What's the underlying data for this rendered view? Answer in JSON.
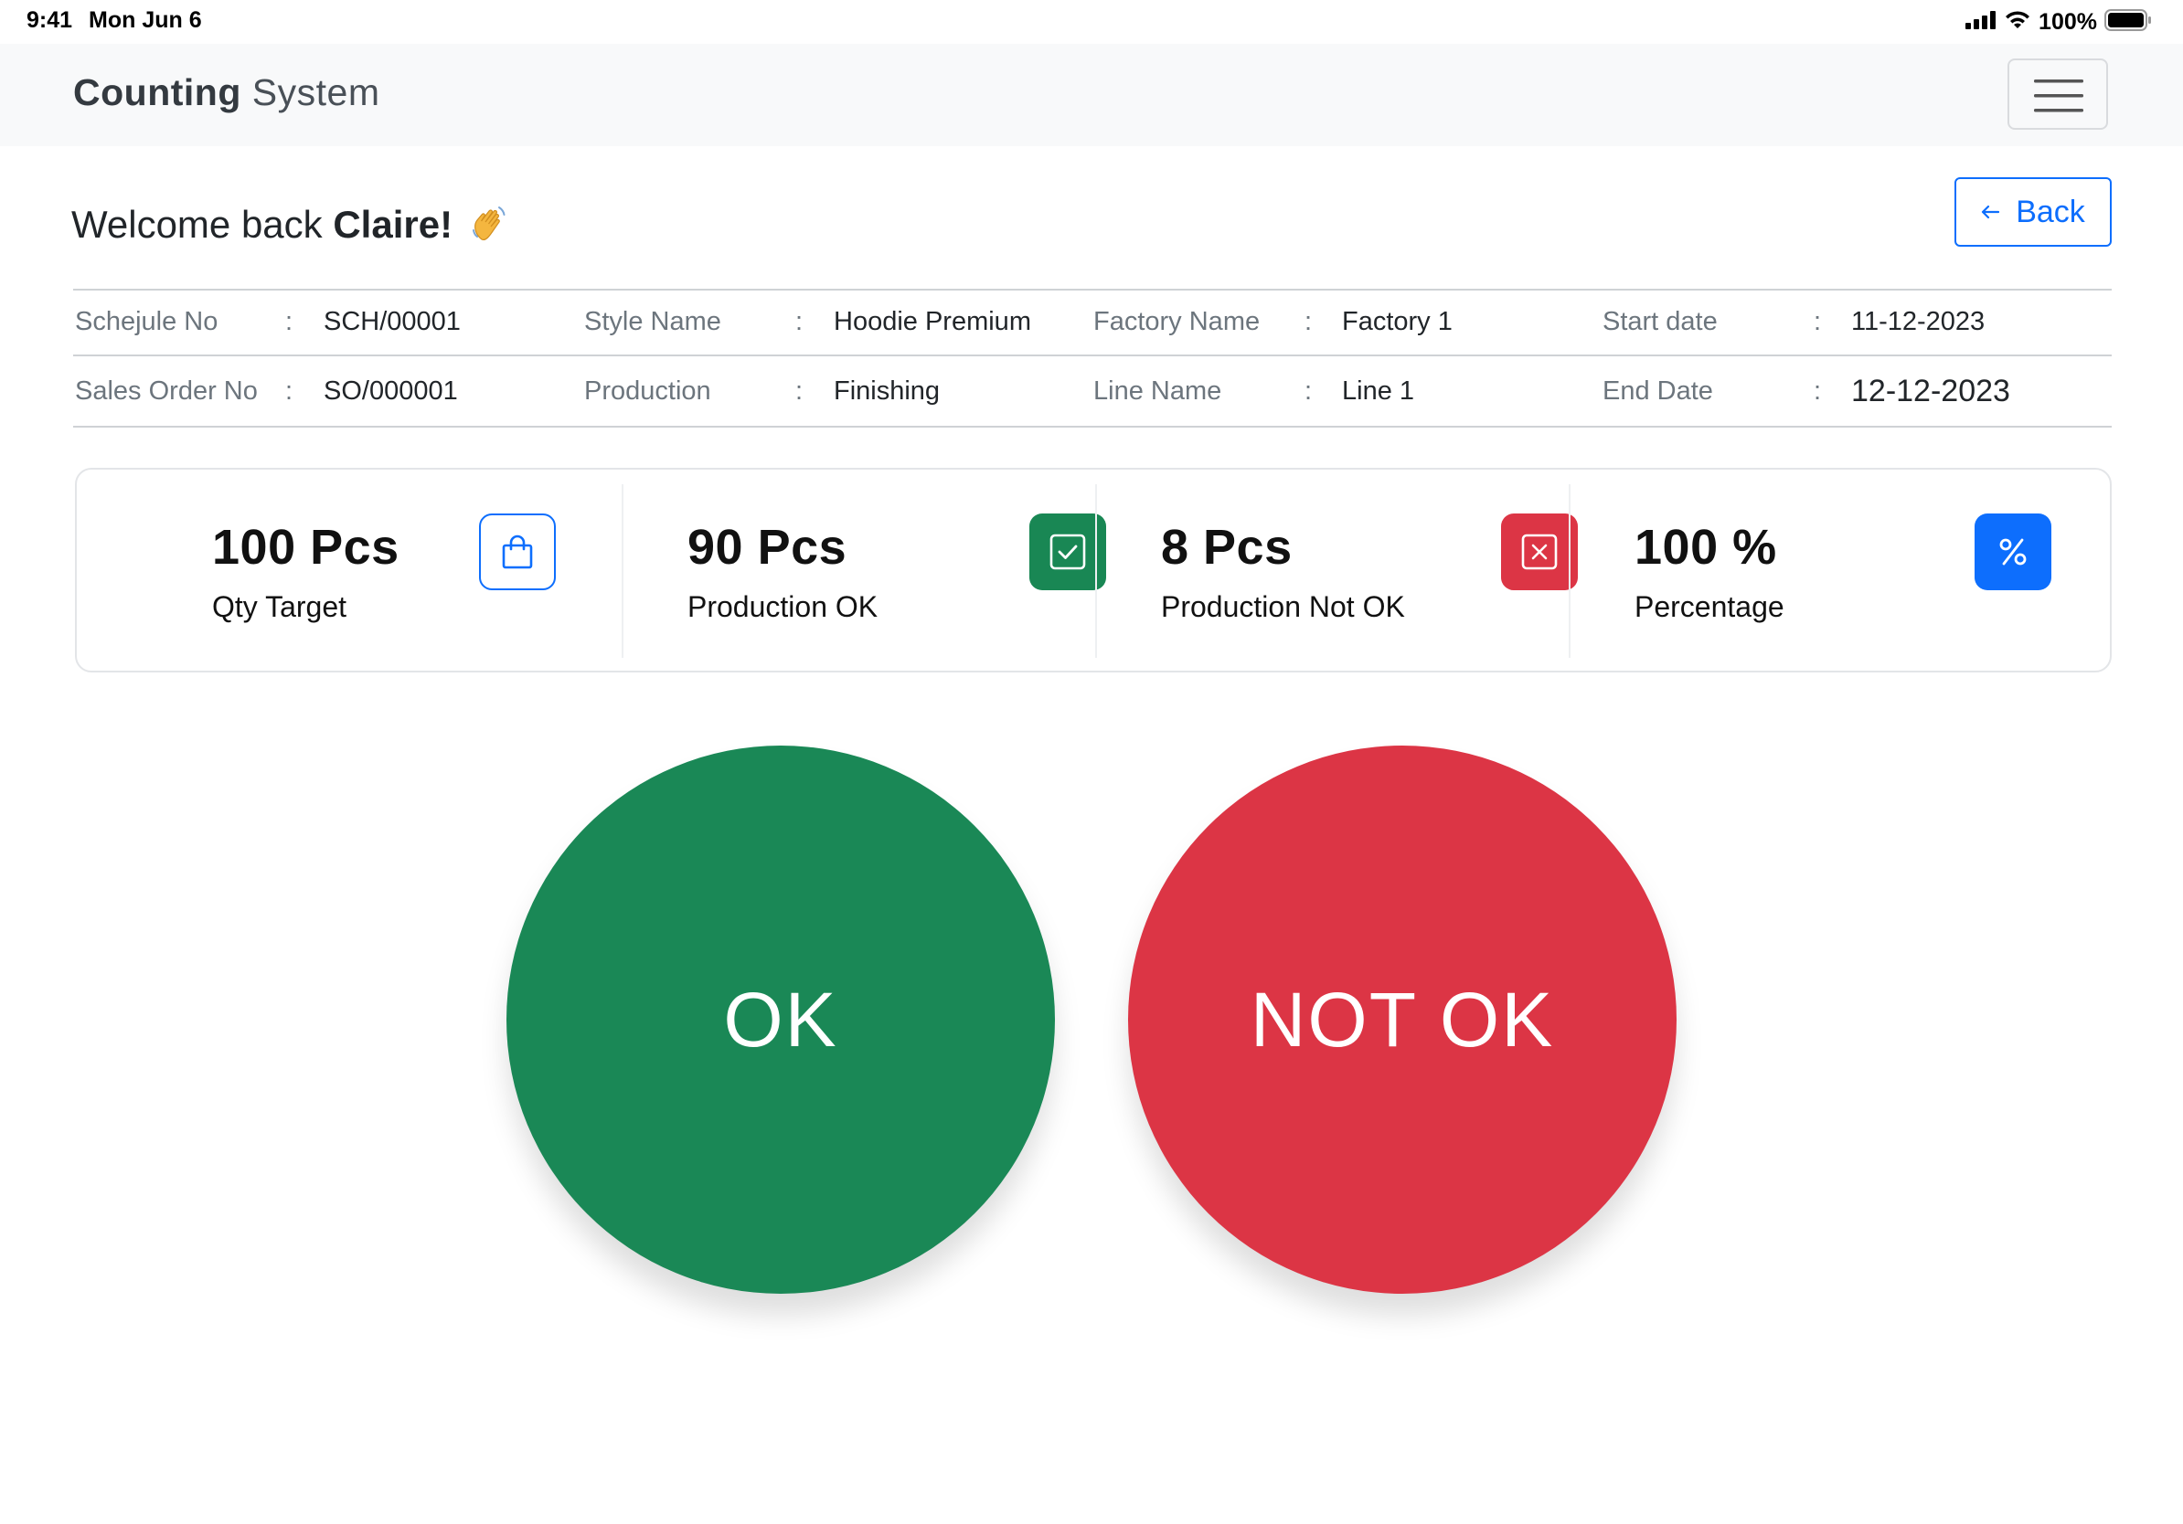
{
  "status_bar": {
    "time": "9:41",
    "date": "Mon Jun 6",
    "battery": "100%"
  },
  "navbar": {
    "brand_bold": "Counting",
    "brand_light": "System"
  },
  "welcome": {
    "prefix": "Welcome back ",
    "name": "Claire!",
    "emoji": "waving-hand-icon"
  },
  "back_button": {
    "label": "Back"
  },
  "info": {
    "row1": [
      {
        "label": "Schejule No",
        "value": "SCH/00001"
      },
      {
        "label": "Style Name",
        "value": "Hoodie Premium"
      },
      {
        "label": "Factory Name",
        "value": "Factory 1"
      },
      {
        "label": "Start date",
        "value": "11-12-2023"
      }
    ],
    "row2": [
      {
        "label": "Sales Order No",
        "value": "SO/000001"
      },
      {
        "label": "Production",
        "value": "Finishing"
      },
      {
        "label": "Line Name",
        "value": "Line 1"
      },
      {
        "label": "End Date",
        "value": "12-12-2023"
      }
    ],
    "separator": ":"
  },
  "stats": [
    {
      "value": "100 Pcs",
      "label": "Qty Target",
      "icon": "shopping-bag-icon",
      "color": "#0d6efd"
    },
    {
      "value": "90 Pcs",
      "label": "Production OK",
      "icon": "check-square-icon",
      "color": "#198754"
    },
    {
      "value": "8 Pcs",
      "label": "Production Not OK",
      "icon": "x-square-icon",
      "color": "#dc3545"
    },
    {
      "value": "100 %",
      "label": "Percentage",
      "icon": "percent-icon",
      "color": "#0d6efd"
    }
  ],
  "actions": {
    "ok_label": "OK",
    "not_ok_label": "NOT OK",
    "ok_color": "#1a8856",
    "not_ok_color": "#dc3545"
  }
}
